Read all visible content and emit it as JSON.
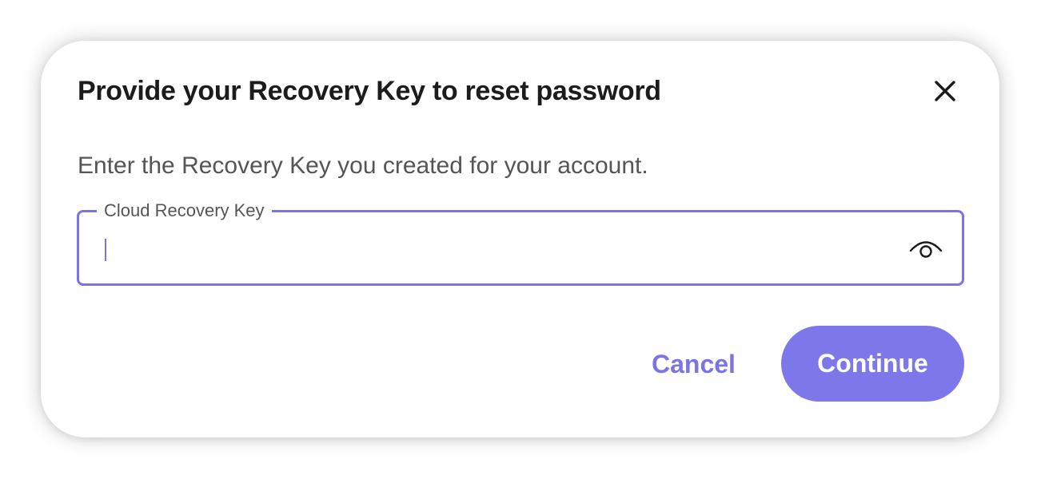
{
  "dialog": {
    "title": "Provide your Recovery Key to reset password",
    "close_icon": "close-icon",
    "description": "Enter the Recovery Key you created for your account.",
    "field": {
      "label": "Cloud Recovery Key",
      "value": "",
      "placeholder": "",
      "toggle_icon": "eye-icon"
    },
    "buttons": {
      "cancel_label": "Cancel",
      "continue_label": "Continue"
    }
  },
  "colors": {
    "accent": "#7b74e6",
    "primary_button": "#7d77ea",
    "title_text": "#1c1c1c",
    "body_text": "#555555"
  }
}
